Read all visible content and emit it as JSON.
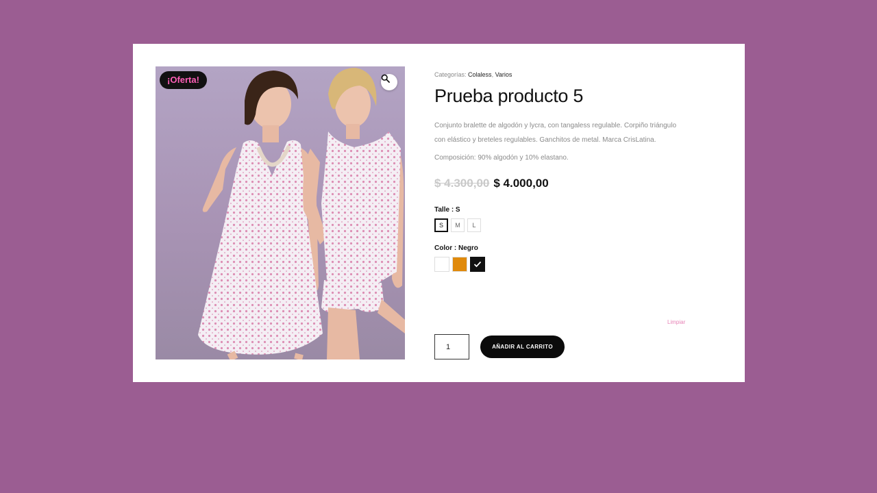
{
  "product": {
    "sale_badge": "¡Oferta!",
    "categories_label": "Categorías:",
    "categories": [
      "Colaless",
      "Varios"
    ],
    "categories_separator": ", ",
    "title": "Prueba producto 5",
    "description": "Conjunto bralette de algodón y lycra, con tangaless regulable. Corpiño triángulo con elástico y breteles regulables. Ganchitos de metal. Marca CrisLatina.",
    "composition": "Composición: 90% algodón y 10% elastano.",
    "old_price": "$ 4.300,00",
    "new_price": "$ 4.000,00"
  },
  "size": {
    "label": "Talle",
    "selected_text": " : S",
    "options": [
      "S",
      "M",
      "L"
    ],
    "selected": "S"
  },
  "color": {
    "label": "Color",
    "selected_text": " : Negro",
    "options": [
      {
        "name": "white",
        "hex": "#ffffff"
      },
      {
        "name": "orange",
        "hex": "#e08a0c"
      },
      {
        "name": "black",
        "hex": "#111111"
      }
    ],
    "selected": "black"
  },
  "clear_label": "Limpiar",
  "quantity": "1",
  "add_to_cart_label": "AÑADIR AL CARRITO",
  "icons": {
    "zoom": "magnifier-icon",
    "check": "checkmark-icon"
  },
  "colors": {
    "page_bg": "#9b5d92",
    "badge_text": "#ff5fb8",
    "clear_link": "#e783b6"
  }
}
